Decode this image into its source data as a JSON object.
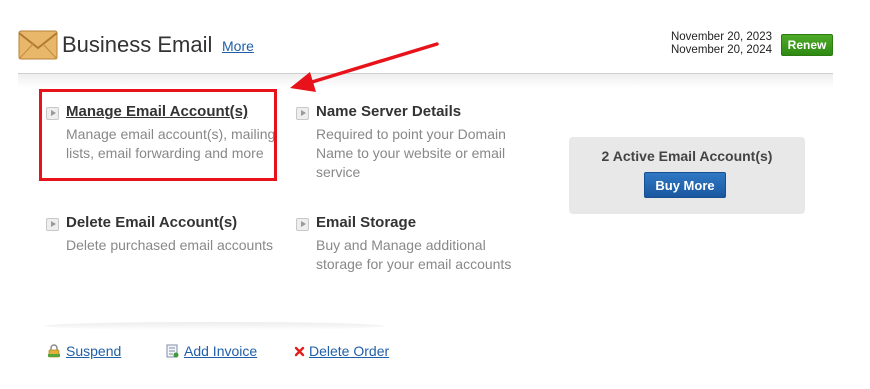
{
  "header": {
    "title": "Business Email",
    "more_label": "More",
    "date_start": "November 20, 2023",
    "date_end": "November 20, 2024",
    "renew_label": "Renew"
  },
  "options": {
    "manage": {
      "title": "Manage Email Account(s)",
      "description": "Manage email account(s), mailing lists, email forwarding and more"
    },
    "name_server": {
      "title": "Name Server Details",
      "description": "Required to point your Domain Name to your website or email service"
    },
    "delete": {
      "title": "Delete Email Account(s)",
      "description": "Delete purchased email accounts"
    },
    "storage": {
      "title": "Email Storage",
      "description": "Buy and Manage additional storage for your email accounts"
    }
  },
  "panel": {
    "active_count": "2 Active Email Account(s)",
    "buy_more_label": "Buy More"
  },
  "footer": {
    "suspend_label": "Suspend",
    "add_invoice_label": "Add Invoice",
    "delete_order_label": "Delete Order"
  },
  "icons": {
    "product": "envelope-icon",
    "option": "arrow-right-icon",
    "suspend": "lock-icon",
    "add_invoice": "invoice-icon",
    "delete_order": "red-x-icon"
  },
  "colors": {
    "link": "#1f5fa8",
    "renew_button": "#3a9a1c",
    "buy_more_button": "#1f64b0",
    "highlight": "#e8121b",
    "panel_background": "#e8e8e8"
  }
}
